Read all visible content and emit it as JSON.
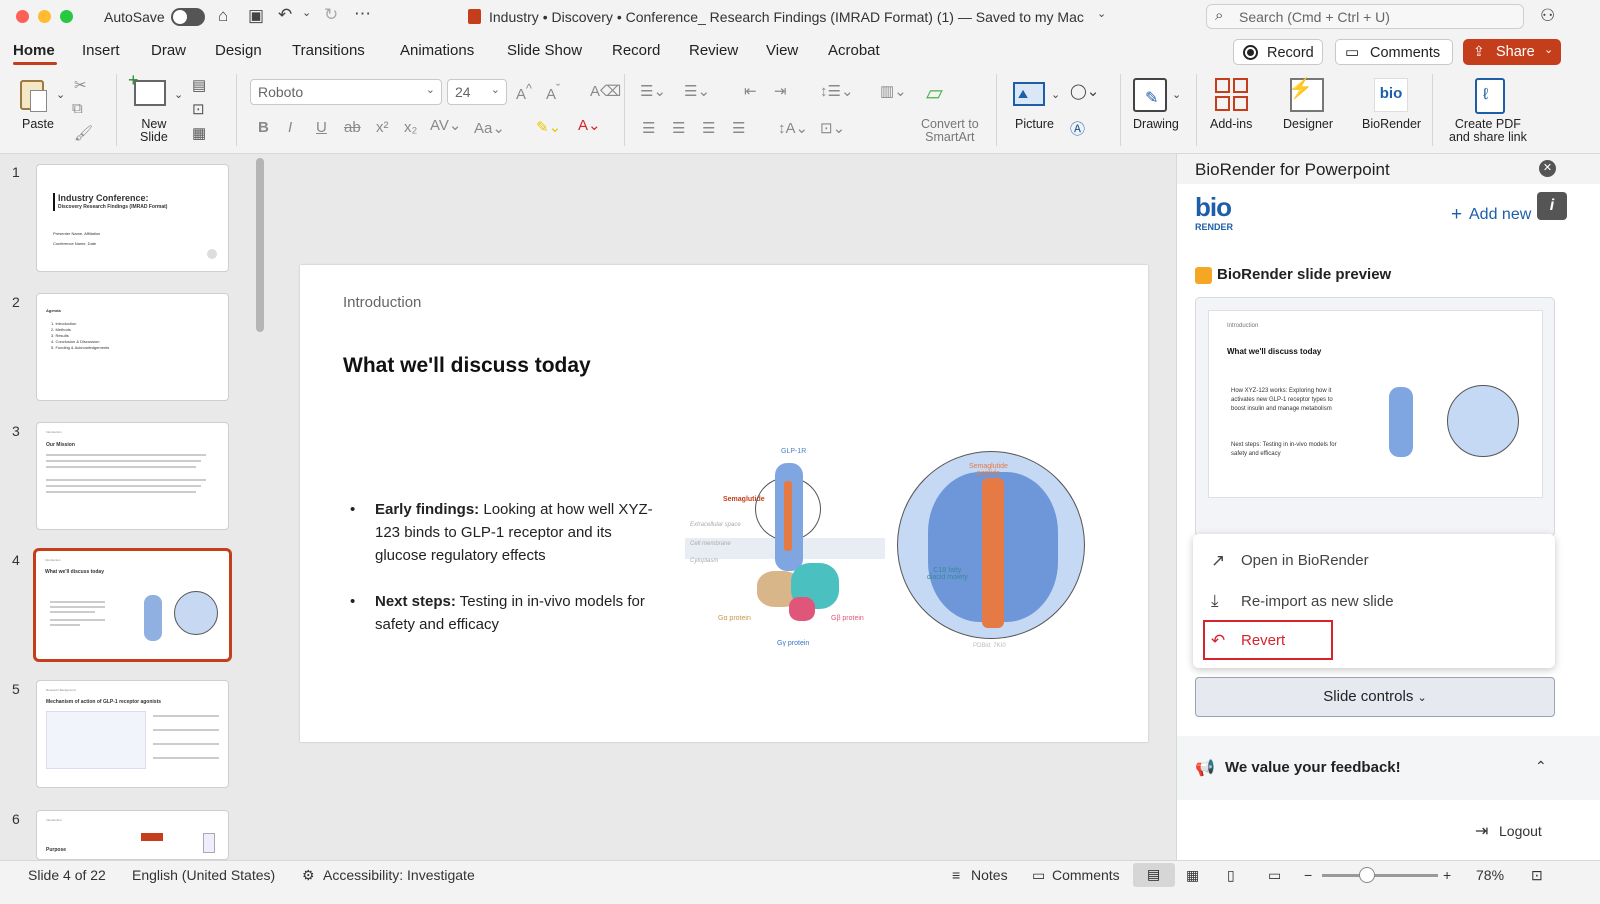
{
  "titlebar": {
    "autosave_label": "AutoSave",
    "doc_title": "Industry • Discovery • Conference_ Research Findings (IMRAD Format) (1) — Saved to my Mac",
    "search_placeholder": "Search (Cmd + Ctrl + U)"
  },
  "tabs": [
    "Home",
    "Insert",
    "Draw",
    "Design",
    "Transitions",
    "Animations",
    "Slide Show",
    "Record",
    "Review",
    "View",
    "Acrobat"
  ],
  "active_tab": "Home",
  "top_buttons": {
    "record": "Record",
    "comments": "Comments",
    "share": "Share"
  },
  "ribbon": {
    "paste": "Paste",
    "new_slide": "New\nSlide",
    "font_name": "Roboto",
    "font_size": "24",
    "convert_smartart": "Convert to\nSmartArt",
    "picture": "Picture",
    "drawing": "Drawing",
    "addins": "Add-ins",
    "designer": "Designer",
    "biorender": "BioRender",
    "create_pdf": "Create PDF\nand share link"
  },
  "thumbnails": [
    {
      "num": "1",
      "title": "Industry Conference:",
      "subtitle": "Discovery Research Findings (IMRAD Format)",
      "lines": [
        "Presenter Name, Affiliation",
        "Conference Name, Date"
      ]
    },
    {
      "num": "2",
      "title": "Agenda",
      "lines": [
        "1. Introduction",
        "2. Methods",
        "3. Results",
        "4. Conclusion & Discussion",
        "5. Funding & Acknowledgements"
      ]
    },
    {
      "num": "3",
      "section": "Introduction",
      "title": "Our Mission"
    },
    {
      "num": "4",
      "section": "Introduction",
      "title": "What we'll discuss today"
    },
    {
      "num": "5",
      "section": "Research Background",
      "title": "Mechanism of action of GLP-1 receptor agonists"
    },
    {
      "num": "6",
      "section": "Introduction",
      "title": "Purpose"
    }
  ],
  "slide": {
    "section": "Introduction",
    "title": "What we'll discuss today",
    "bullets": [
      {
        "bold": "Early findings:",
        "text": " Looking at how well XYZ-123 binds to GLP-1 receptor and its glucose regulatory effects"
      },
      {
        "bold": "Next steps:",
        "text": " Testing in in-vivo models for safety and efficacy"
      }
    ],
    "figure_labels": {
      "glp1r": "GLP-1R",
      "semaglutide": "Semaglutide",
      "extracellular": "Extracellular space",
      "membrane": "Cell membrane",
      "cytoplasm": "Cytoplasm",
      "ga": "Gα protein",
      "gb": "Gβ protein",
      "gg": "Gγ protein",
      "sema_peptide": "Semaglutide\npeptide",
      "c18": "C18 fatty\ndiacid moiety",
      "pdb": "PDBid: 7KI0"
    }
  },
  "pane": {
    "title": "BioRender for Powerpoint",
    "logo": "bio",
    "logo_sub": "RENDER",
    "add_new": "Add new",
    "preview_heading": "BioRender slide preview",
    "preview": {
      "section": "Introduction",
      "title": "What we'll discuss today",
      "b1": "How XYZ-123 works: Exploring how it activates new GLP-1 receptor types to boost insulin and manage metabolism",
      "b2": "Next steps: Testing in in-vivo models for safety and efficacy"
    },
    "menu": [
      "Open in BioRender",
      "Re-import as new slide",
      "Revert"
    ],
    "slide_controls": "Slide controls",
    "feedback": "We value your feedback!",
    "logout": "Logout"
  },
  "status": {
    "slide_of": "Slide 4 of 22",
    "language": "English (United States)",
    "accessibility": "Accessibility: Investigate",
    "notes": "Notes",
    "comments": "Comments",
    "zoom": "78%"
  },
  "colors": {
    "accent": "#c43e1c",
    "biorender_blue": "#1d5ea8",
    "revert_red": "#d6232c"
  }
}
